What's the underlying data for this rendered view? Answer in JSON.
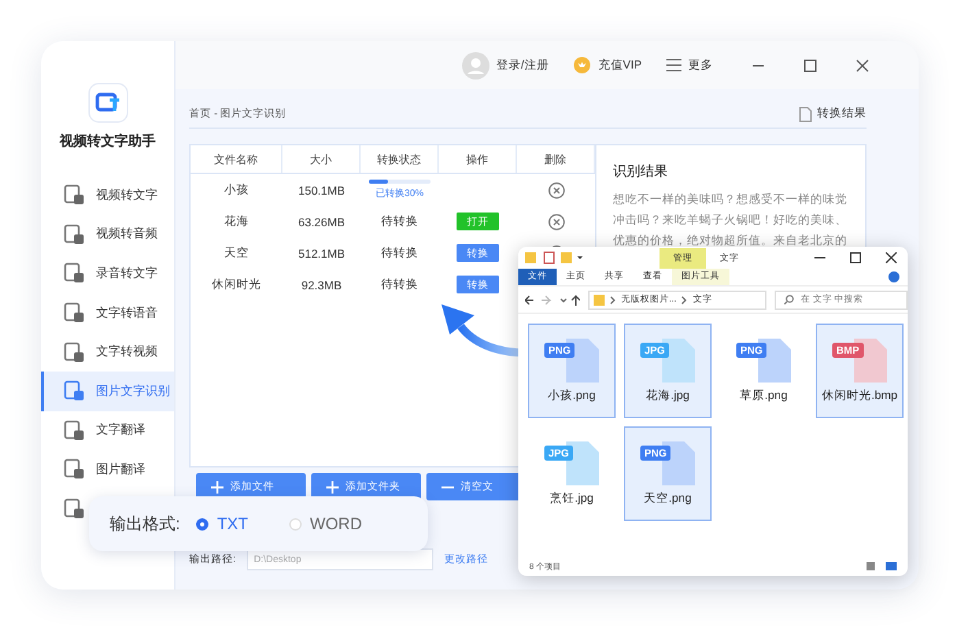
{
  "app": {
    "title": "视频转文字助手",
    "top_bar": {
      "login": "登录/注册",
      "vip": "充值VIP",
      "more": "更多"
    },
    "sidebar": {
      "items": [
        {
          "label": "视频转文字",
          "selected": false
        },
        {
          "label": "视频转音频",
          "selected": false
        },
        {
          "label": "录音转文字",
          "selected": false
        },
        {
          "label": "文字转语音",
          "selected": false
        },
        {
          "label": "文字转视频",
          "selected": false
        },
        {
          "label": "图片文字识别",
          "selected": true
        },
        {
          "label": "文字翻译",
          "selected": false
        },
        {
          "label": "图片翻译",
          "selected": false
        },
        {
          "selected": false
        }
      ]
    },
    "breadcrumb": "首页 - 图片文字识别",
    "result_link": "转换结果",
    "table": {
      "columns": [
        "文件名称",
        "大小",
        "转换状态",
        "操作",
        "删除"
      ],
      "rows": [
        {
          "name": "小孩",
          "size": "150.1MB",
          "status": {
            "kind": "progress",
            "text": "已转换30%",
            "level": 0.3
          }
        },
        {
          "name": "花海",
          "size": "63.26MB",
          "status": {
            "kind": "pending",
            "text": "待转换"
          },
          "action": {
            "kind": "open",
            "label": "打开"
          }
        },
        {
          "name": "天空",
          "size": "512.1MB",
          "status": {
            "kind": "pending",
            "text": "待转换"
          },
          "action": {
            "kind": "convert",
            "label": "转换"
          }
        },
        {
          "name": "休闲时光",
          "size": "92.3MB",
          "status": {
            "kind": "pending",
            "text": "待转换"
          },
          "action": {
            "kind": "convert",
            "label": "转换"
          }
        }
      ]
    },
    "result": {
      "title": "识别结果",
      "text": "想吃不一样的美味吗？想感受不一样的味觉冲击吗？来吃羊蝎子火锅吧！好吃的美味、优惠的价格，绝对物超所值。来自老北京的"
    },
    "buttons": [
      {
        "kind": "add",
        "label": "添加文件"
      },
      {
        "kind": "add",
        "label": "添加文件夹"
      },
      {
        "kind": "remove",
        "label": "清空文"
      }
    ],
    "output_path": {
      "label": "输出路径:",
      "value": "D:\\Desktop",
      "link": "更改路径"
    }
  },
  "format_card": {
    "label": "输出格式:",
    "options": [
      {
        "label": "TXT",
        "selected": true
      },
      {
        "label": "WORD",
        "selected": false
      }
    ]
  },
  "explorer": {
    "context_tab": "管理",
    "title": "文字",
    "ribbon_tabs": [
      {
        "label": "文件",
        "selected": true
      },
      {
        "label": "主页",
        "selected": false
      },
      {
        "label": "共享",
        "selected": false
      },
      {
        "label": "查看",
        "selected": false
      },
      {
        "label": "图片工具",
        "selected": false
      }
    ],
    "path": [
      "无版权图片...",
      "文字"
    ],
    "search": {
      "placeholder": "在 文字 中搜索"
    },
    "files": [
      {
        "name": "小孩.png",
        "kind": "png",
        "badge": "PNG",
        "selected": true
      },
      {
        "name": "花海.jpg",
        "kind": "jpg",
        "badge": "JPG",
        "selected": true
      },
      {
        "name": "草原.png",
        "kind": "png",
        "badge": "PNG",
        "selected": false
      },
      {
        "name": "休闲时光.bmp",
        "kind": "bmp",
        "badge": "BMP",
        "selected": true
      },
      {
        "name": "烹饪.jpg",
        "kind": "jpg",
        "badge": "JPG",
        "selected": false
      },
      {
        "name": "天空.png",
        "kind": "png",
        "badge": "PNG",
        "selected": true
      }
    ],
    "status": "8 个项目"
  }
}
